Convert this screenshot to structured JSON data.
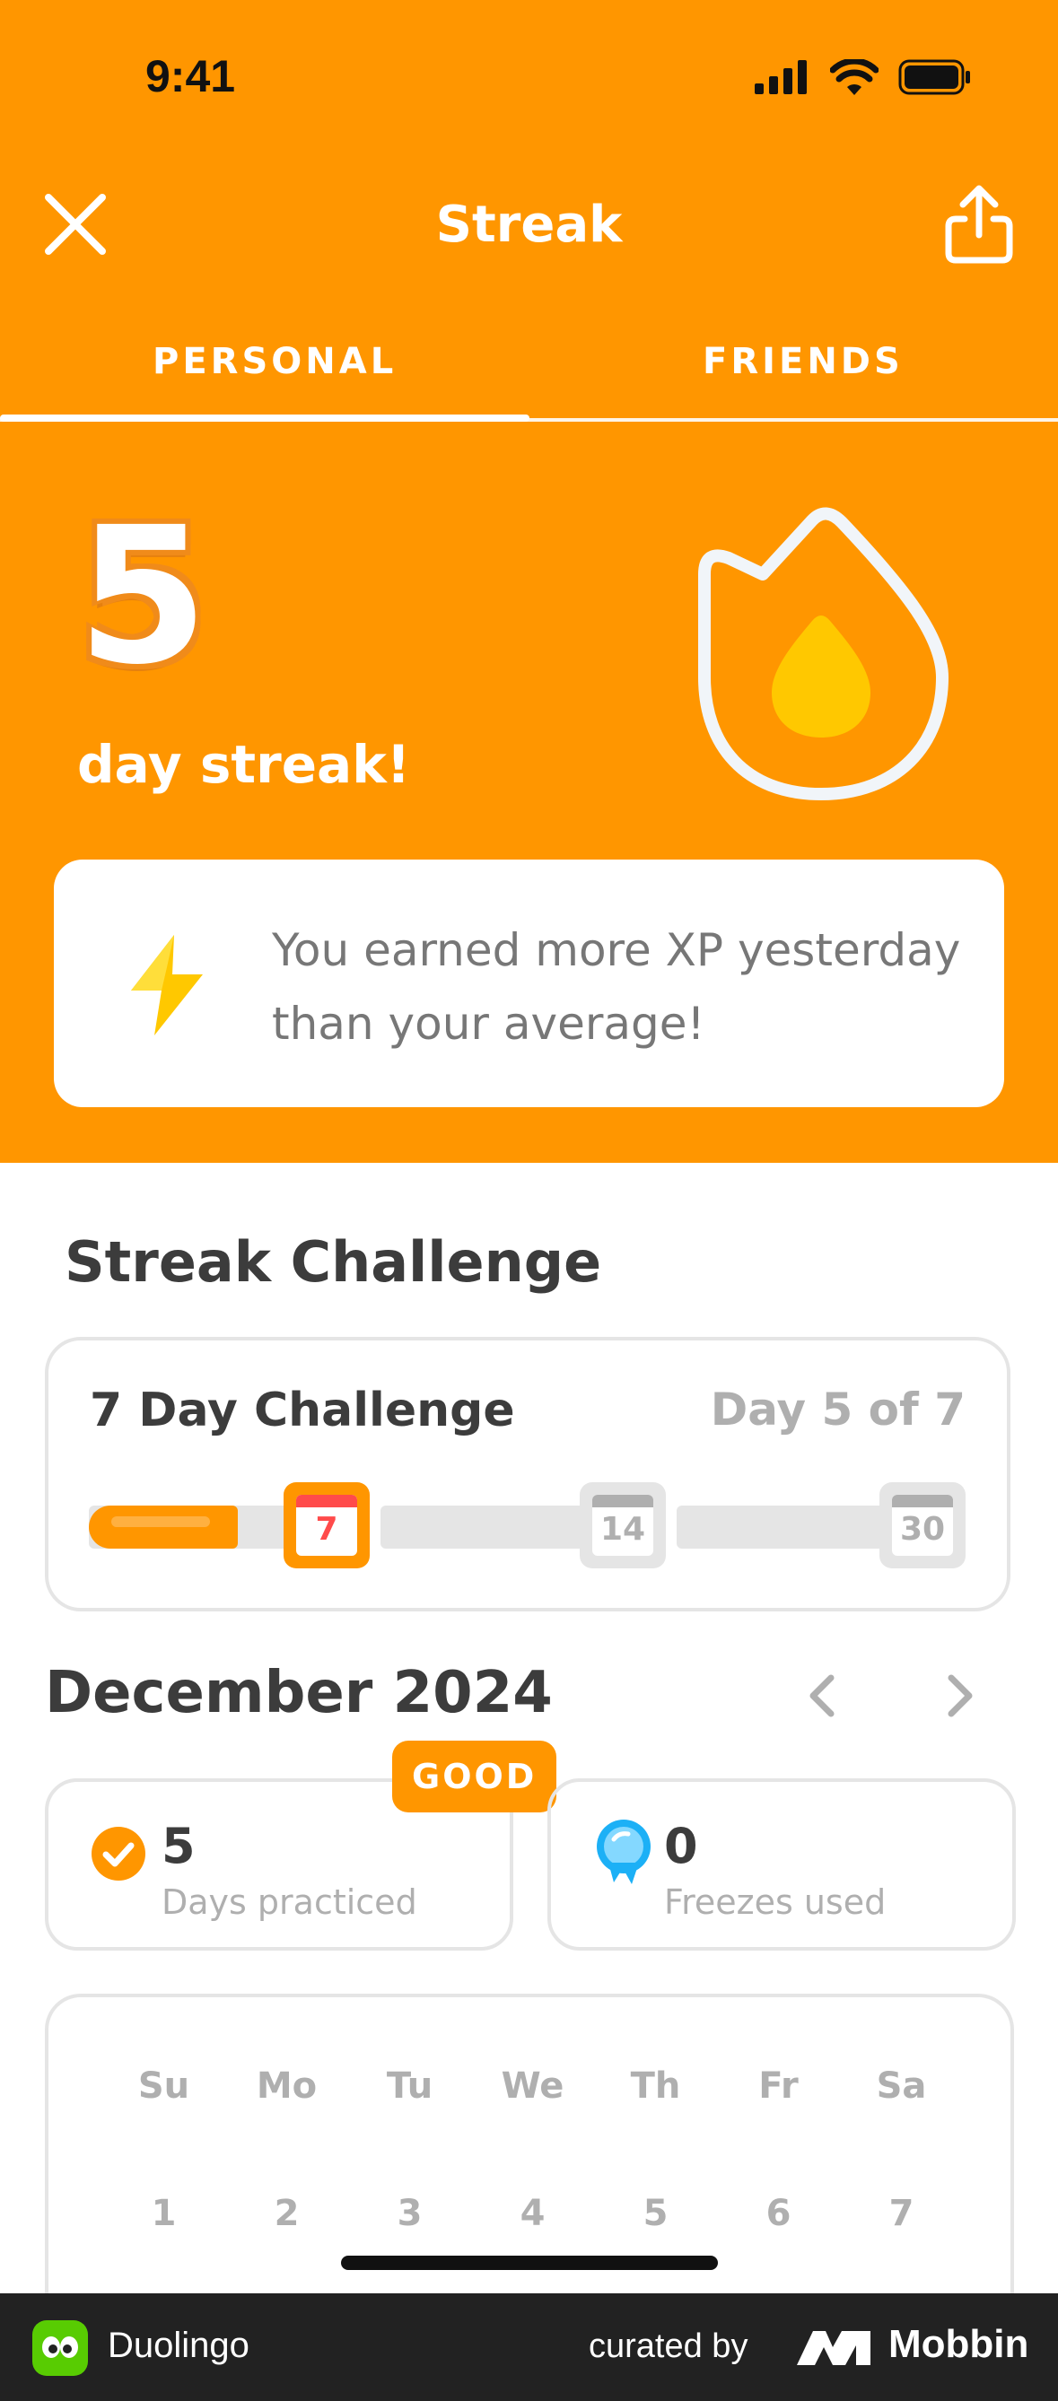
{
  "status_bar": {
    "time": "9:41"
  },
  "nav": {
    "title": "Streak"
  },
  "tabs": [
    {
      "label": "PERSONAL",
      "active": true
    },
    {
      "label": "FRIENDS",
      "active": false
    }
  ],
  "streak": {
    "count": "5",
    "label": "day streak!"
  },
  "xp_message": {
    "text": "You earned more XP yesterday than your average!",
    "icon": "lightning-icon"
  },
  "challenge": {
    "section_title": "Streak Challenge",
    "name": "7 Day Challenge",
    "progress_text": "Day 5 of 7",
    "progress_fraction": 0.71,
    "milestones": [
      "7",
      "14",
      "30"
    ],
    "active_milestone": "7"
  },
  "calendar": {
    "month": "December 2024",
    "badge": "GOOD",
    "stats": [
      {
        "value": "5",
        "label": "Days practiced",
        "icon": "check-circle-icon"
      },
      {
        "value": "0",
        "label": "Freezes used",
        "icon": "freeze-icon"
      }
    ],
    "weekdays": [
      "Su",
      "Mo",
      "Tu",
      "We",
      "Th",
      "Fr",
      "Sa"
    ],
    "first_week": [
      "1",
      "2",
      "3",
      "4",
      "5",
      "6",
      "7"
    ]
  },
  "footer": {
    "app": "Duolingo",
    "curated": "curated by",
    "brand": "Mobbin"
  },
  "colors": {
    "primary": "#FF9600",
    "muted": "#AFAFAF",
    "text": "#3C3C3C",
    "track": "#E5E5E5"
  }
}
